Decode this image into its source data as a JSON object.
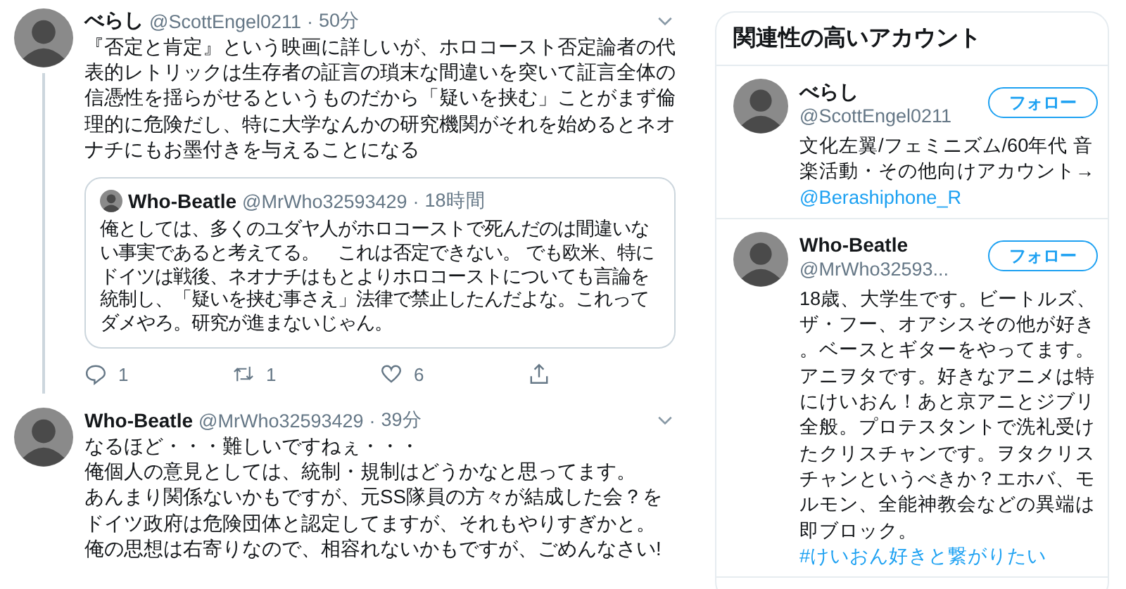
{
  "timeline": {
    "tweets": [
      {
        "name": "べらし",
        "handle": "@ScottEngel0211",
        "separator": "·",
        "time": "50分",
        "text": "『否定と肯定』という映画に詳しいが、ホロコースト否定論者の代表的レトリックは生存者の証言の瑣末な間違いを突いて証言全体の信憑性を揺らがせるというものだから「疑いを挟む」ことがまず倫理的に危険だし、特に大学なんかの研究機関がそれを始めるとネオナチにもお墨付きを与えることになる",
        "quote": {
          "name": "Who-Beatle",
          "handle": "@MrWho32593429",
          "separator": "·",
          "time": "18時間",
          "text": "俺としては、多くのユダヤ人がホロコーストで死んだのは間違いない事実であると考えてる。　これは否定できない。 でも欧米、特にドイツは戦後、ネオナチはもとよりホロコーストについても言論を統制し、「疑いを挟む事さえ」法律で禁止したんだよな。これってダメやろ。研究が進まないじゃん。"
        },
        "actions": {
          "replies": "1",
          "retweets": "1",
          "likes": "6"
        }
      },
      {
        "name": "Who-Beatle",
        "handle": "@MrWho32593429",
        "separator": "·",
        "time": "39分",
        "lines": [
          "なるほど・・・難しいですねぇ・・・",
          "俺個人の意見としては、統制・規制はどうかなと思ってます。",
          "あんまり関係ないかもですが、元SS隊員の方々が結成した会？をドイツ政府は危険団体と認定してますが、それもやりすぎかと。",
          "俺の思想は右寄りなので、相容れないかもですが、ごめんなさい!"
        ]
      }
    ]
  },
  "sidebar": {
    "title": "関連性の高いアカウント",
    "accounts": [
      {
        "name": "べらし",
        "handle": "@ScottEngel0211",
        "follow": "フォロー",
        "bio": "文化左翼/フェミニズム/60年代 音楽活動・その他向けアカウント→",
        "link": "@Berashiphone_R"
      },
      {
        "name": "Who-Beatle",
        "handle": "@MrWho32593...",
        "follow": "フォロー",
        "bio": "18歳、大学生です。ビートルズ、ザ・フー、オアシスその他が好き。ベースとギターをやってます。アニヲタです。好きなアニメは特にけいおん！あと京アニとジブリ全般。プロテスタントで洗礼受けたクリスチャンです。ヲタクリスチャンというべきか？エホバ、モルモン、全能神教会などの異端は即ブロック。 ",
        "link": "#けいおん好きと繋がりたい"
      }
    ]
  }
}
